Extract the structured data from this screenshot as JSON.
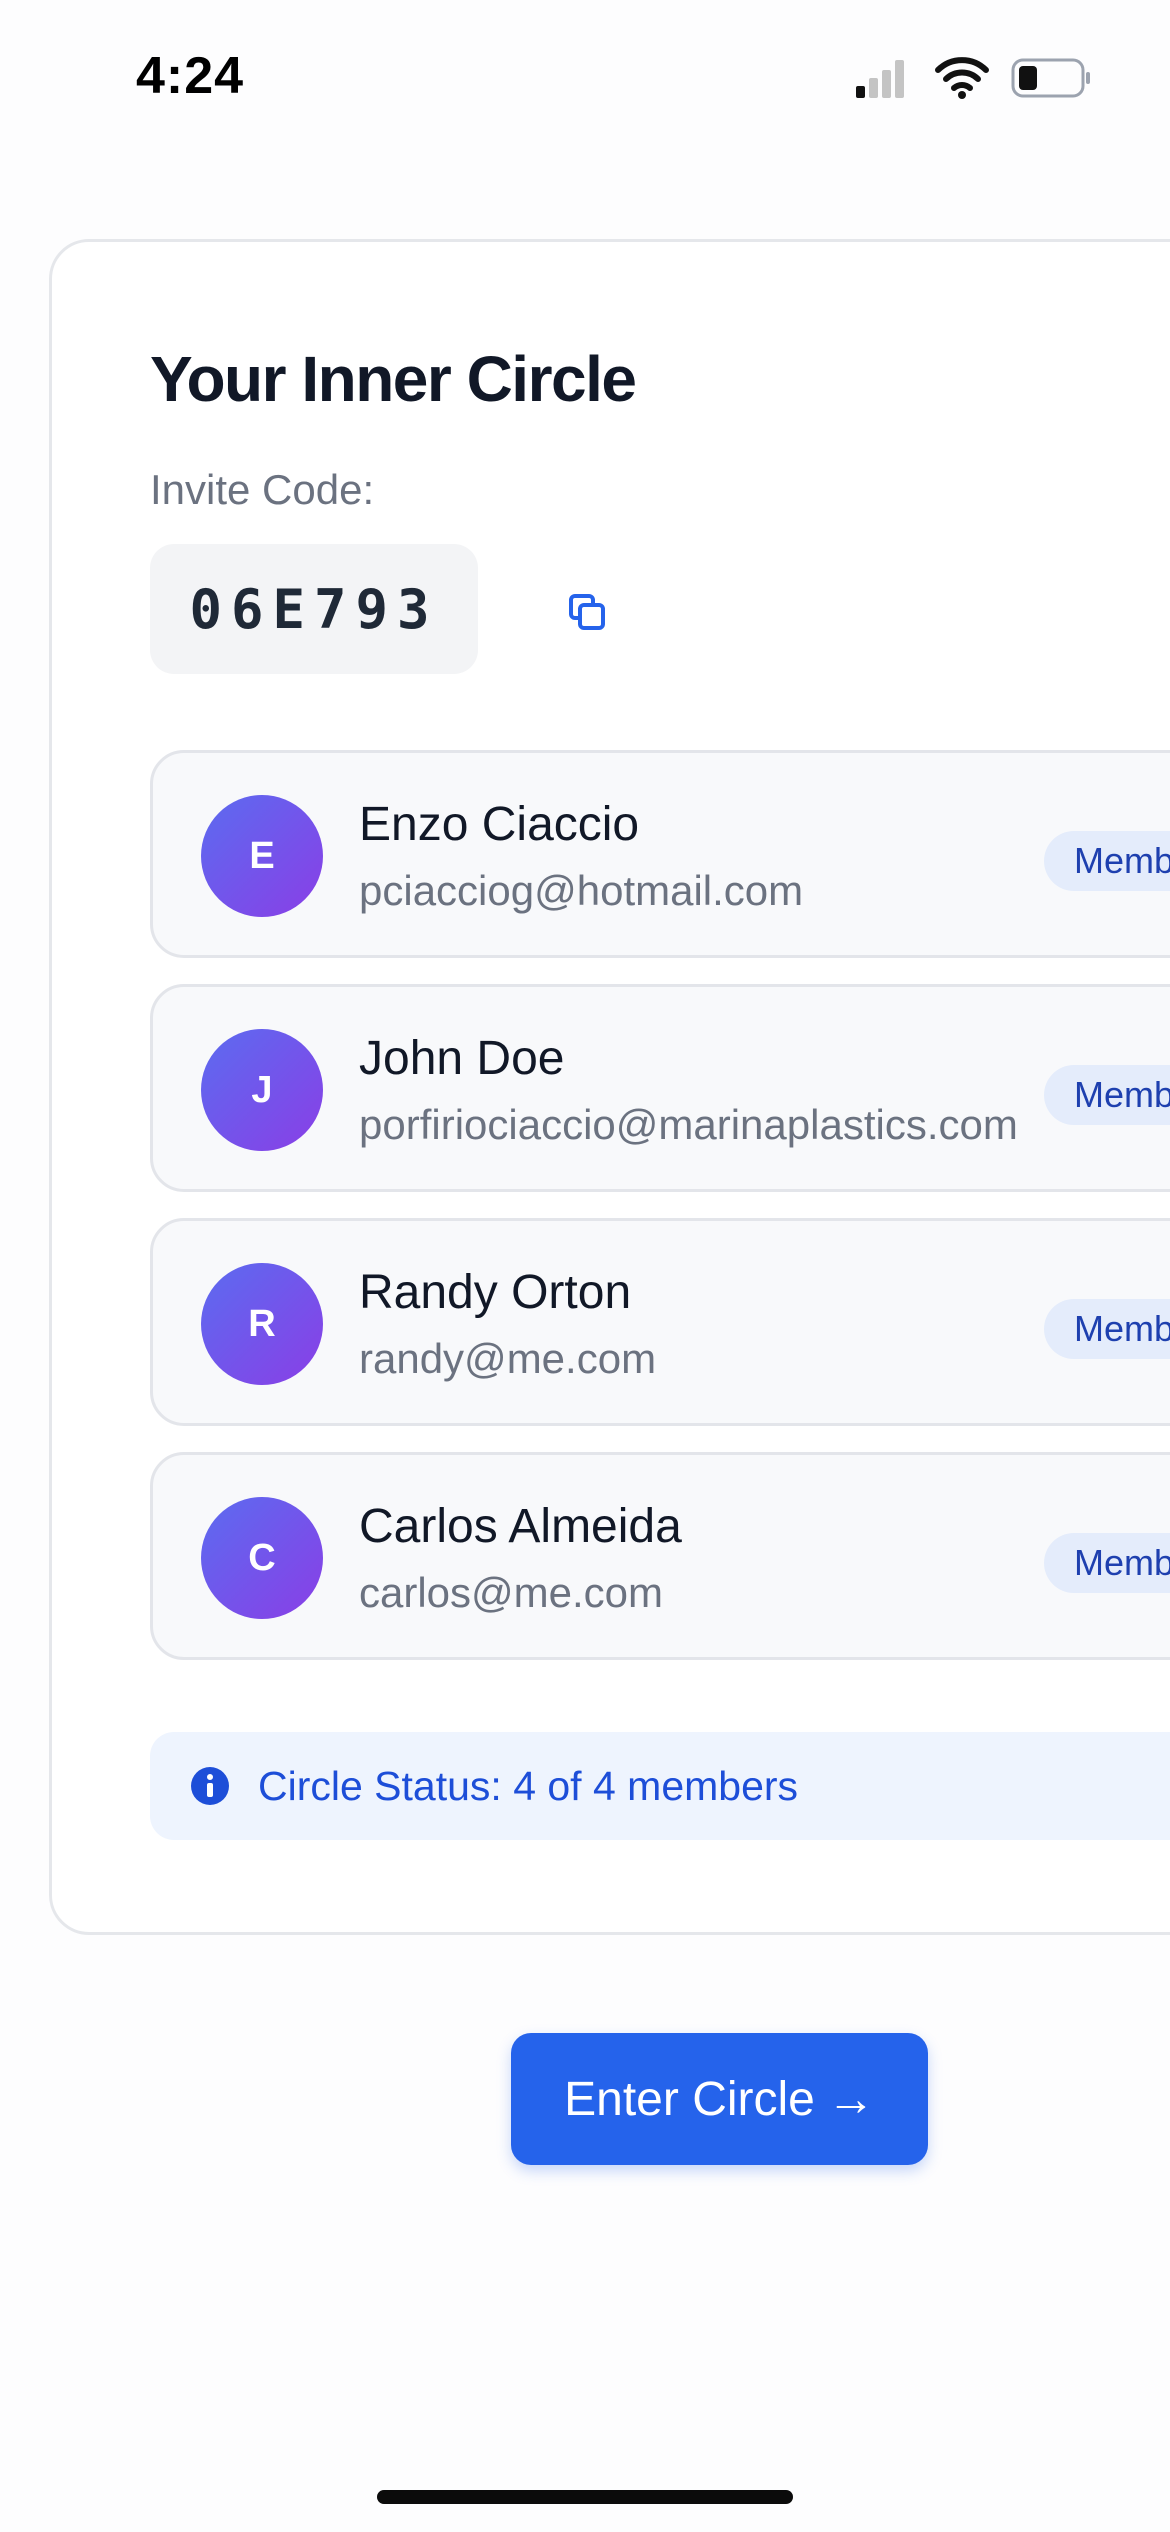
{
  "status_bar": {
    "time": "4:24",
    "icons": [
      "cellular-signal-icon",
      "wifi-icon",
      "battery-icon"
    ]
  },
  "card": {
    "title": "Your Inner Circle",
    "invite_label": "Invite Code:",
    "invite_code": "06E793",
    "copy_icon": "copy-icon"
  },
  "members": [
    {
      "initial": "E",
      "name": "Enzo Ciaccio",
      "email": "pciacciog@hotmail.com",
      "role": "Member"
    },
    {
      "initial": "J",
      "name": "John Doe",
      "email": "porfiriociaccio@marinaplastics.com",
      "role": "Member"
    },
    {
      "initial": "R",
      "name": "Randy Orton",
      "email": "randy@me.com",
      "role": "Member"
    },
    {
      "initial": "C",
      "name": "Carlos Almeida",
      "email": "carlos@me.com",
      "role": "Member"
    }
  ],
  "circle_status": {
    "icon": "info-icon",
    "text": "Circle Status: 4 of 4 members"
  },
  "enter_button": {
    "label": "Enter Circle",
    "arrow": "→"
  },
  "colors": {
    "accent": "#2563eb",
    "avatar_gradient_start": "#5b6cf0",
    "avatar_gradient_end": "#8a3ee6",
    "badge_bg": "#e4ecfb",
    "badge_text": "#1e40af",
    "status_bg": "#eef4fe"
  }
}
